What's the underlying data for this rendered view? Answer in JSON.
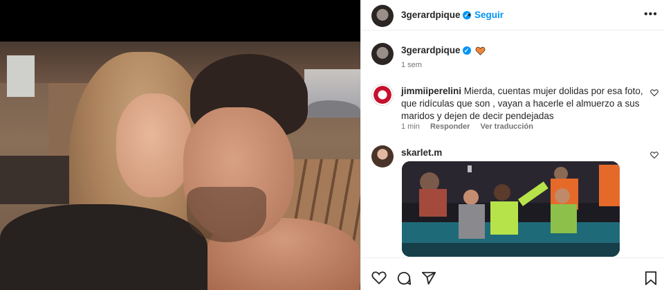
{
  "post": {
    "author": "3gerardpique",
    "follow_label": "Seguir",
    "separator": "•",
    "more_label": "•••"
  },
  "caption": {
    "author": "3gerardpique",
    "age": "1 sem"
  },
  "comments": [
    {
      "author": "jimmiiperelini",
      "text": "Mierda, cuentas mujer dolidas por esa foto, que ridículas que son , vayan a hacerle el almuerzo a sus maridos y dejen de decir pendejadas",
      "age": "1 min",
      "reply_label": "Responder",
      "translate_label": "Ver traducción"
    },
    {
      "author": "skarlet.m"
    }
  ],
  "icons": {
    "verified": "verified-badge-icon",
    "caption_emoji": "orange-heart-icon",
    "like": "heart-icon",
    "comment": "comment-icon",
    "share": "share-icon",
    "save": "bookmark-icon"
  },
  "colors": {
    "accent": "#0095f6",
    "emoji_heart": "#f0853a"
  }
}
